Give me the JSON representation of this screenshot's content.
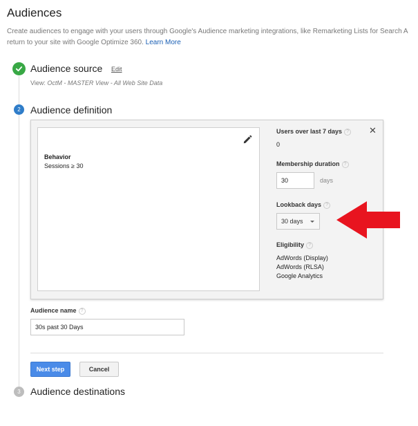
{
  "page": {
    "title": "Audiences",
    "intro_line1": "Create audiences to engage with your users through Google's Audience marketing integrations, like Remarketing Lists for Search A",
    "intro_line2": "return to your site with Google Optimize 360.",
    "learn_more": "Learn More"
  },
  "steps": {
    "source": {
      "title": "Audience source",
      "edit_label": "Edit",
      "view_label": "View:",
      "view_value": "OctM - MASTER View - All Web Site Data"
    },
    "definition": {
      "number": "2",
      "title": "Audience definition"
    },
    "destinations": {
      "number": "3",
      "title": "Audience destinations"
    }
  },
  "definition": {
    "condition_title": "Behavior",
    "condition_value": "Sessions ≥ 30",
    "users_label": "Users over last 7 days",
    "users_value": "0",
    "membership_label": "Membership duration",
    "membership_value": "30",
    "membership_unit": "days",
    "lookback_label": "Lookback days",
    "lookback_value": "30 days",
    "eligibility_label": "Eligibility",
    "eligibility": [
      "AdWords (Display)",
      "AdWords (RLSA)",
      "Google Analytics"
    ],
    "help_glyph": "?",
    "close_glyph": "✕"
  },
  "audience_name": {
    "label": "Audience name",
    "value": "30s past 30 Days"
  },
  "buttons": {
    "next": "Next step",
    "cancel": "Cancel"
  },
  "colors": {
    "accent_blue": "#4a8be8",
    "complete_green": "#38a845",
    "arrow_red": "#e8141f",
    "step_active": "#2f7dc9",
    "step_inactive": "#bdbdbd"
  },
  "icons": {
    "check": "check-icon",
    "pencil": "pencil-icon",
    "close": "close-icon",
    "help": "help-icon",
    "arrow": "red-arrow-icon"
  }
}
